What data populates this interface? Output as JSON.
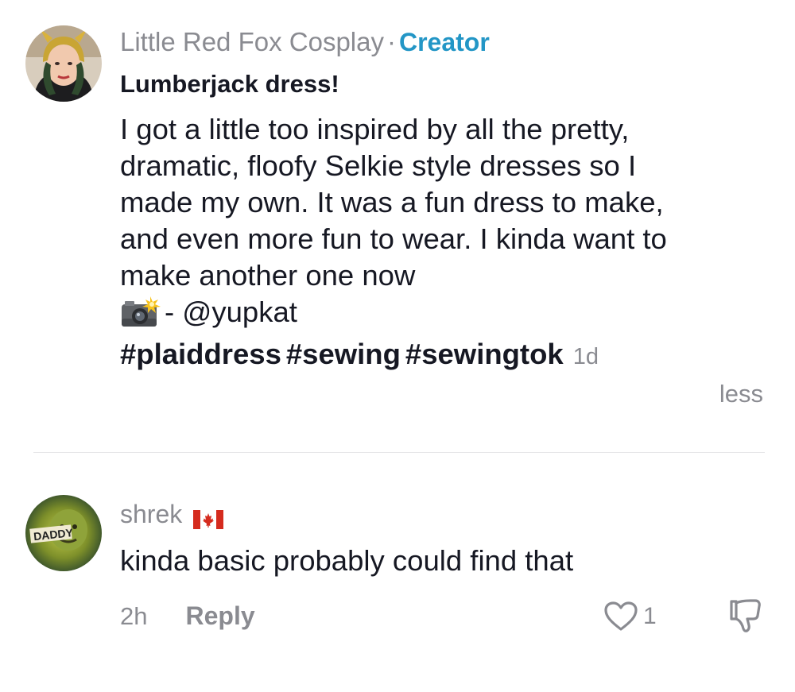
{
  "post": {
    "author": "Little Red Fox Cosplay",
    "separator": "·",
    "badge": "Creator",
    "title": "Lumberjack dress!",
    "body_lines": [
      "I got a little too inspired by all the pretty,",
      "dramatic, floofy Selkie style dresses so I",
      "made my own. It was a fun dress to make,",
      "and even more fun to wear. I kinda want to",
      "make another one now"
    ],
    "credit_emoji": "camera-with-flash",
    "credit": "- @yupkat",
    "hashtags": [
      "#plaiddress",
      "#sewing",
      "#sewingtok"
    ],
    "time": "1d",
    "collapse_label": "less"
  },
  "reply": {
    "author": "shrek",
    "flag": "canada-flag",
    "avatar_text": "DADDY",
    "text": "kinda basic probably could find that",
    "time": "2h",
    "reply_label": "Reply",
    "like_count": "1"
  },
  "colors": {
    "text": "#161823",
    "muted": "#8a8b91",
    "creator_badge": "#2396c6",
    "divider": "#e6e6e8"
  }
}
